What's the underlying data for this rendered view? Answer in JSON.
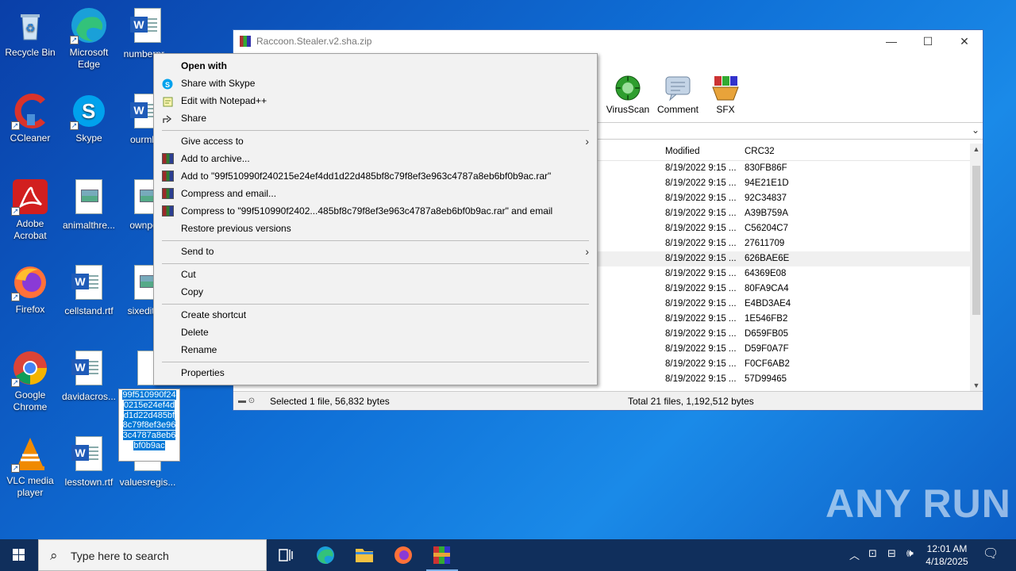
{
  "desktop": {
    "icons": [
      {
        "label": "Recycle Bin"
      },
      {
        "label": "Microsoft Edge"
      },
      {
        "label": "numberpr..."
      },
      {
        "label": "CCleaner"
      },
      {
        "label": "Skype"
      },
      {
        "label": "ourmb..."
      },
      {
        "label": "Adobe Acrobat"
      },
      {
        "label": "animalthre..."
      },
      {
        "label": "ownpo..."
      },
      {
        "label": "Firefox"
      },
      {
        "label": "cellstand.rtf"
      },
      {
        "label": "sixedito..."
      },
      {
        "label": "Google Chrome"
      },
      {
        "label": "davidacros..."
      },
      {
        "label": "VLC media player"
      },
      {
        "label": "lesstown.rtf"
      },
      {
        "label": "valuesregis..."
      }
    ],
    "rename_text": "99f510990f240215e24ef4dd1d22d485bf8c79f8ef3e963c4787a8eb6bf0b9ac"
  },
  "winrar": {
    "title": "Raccoon.Stealer.v2.sha.zip",
    "controls": {
      "minimize": "—",
      "maximize": "☐",
      "close": "✕"
    },
    "toolbar": [
      {
        "label": "VirusScan",
        "icon": "virusscan-icon"
      },
      {
        "label": "Comment",
        "icon": "comment-icon"
      },
      {
        "label": "SFX",
        "icon": "sfx-icon"
      }
    ],
    "columns": {
      "modified": "Modified",
      "crc": "CRC32"
    },
    "rows": [
      {
        "modified": "8/19/2022 9:15 ...",
        "crc": "830FB86F"
      },
      {
        "modified": "8/19/2022 9:15 ...",
        "crc": "94E21E1D"
      },
      {
        "modified": "8/19/2022 9:15 ...",
        "crc": "92C34837"
      },
      {
        "modified": "8/19/2022 9:15 ...",
        "crc": "A39B759A"
      },
      {
        "modified": "8/19/2022 9:15 ...",
        "crc": "C56204C7"
      },
      {
        "modified": "8/19/2022 9:15 ...",
        "crc": "27611709"
      },
      {
        "modified": "8/19/2022 9:15 ...",
        "crc": "626BAE6E"
      },
      {
        "modified": "8/19/2022 9:15 ...",
        "crc": "64369E08"
      },
      {
        "modified": "8/19/2022 9:15 ...",
        "crc": "80FA9CA4"
      },
      {
        "modified": "8/19/2022 9:15 ...",
        "crc": "E4BD3AE4"
      },
      {
        "modified": "8/19/2022 9:15 ...",
        "crc": "1E546FB2"
      },
      {
        "modified": "8/19/2022 9:15 ...",
        "crc": "D659FB05"
      },
      {
        "modified": "8/19/2022 9:15 ...",
        "crc": "D59F0A7F"
      },
      {
        "modified": "8/19/2022 9:15 ...",
        "crc": "F0CF6AB2"
      },
      {
        "modified": "8/19/2022 9:15 ...",
        "crc": "57D99465"
      }
    ],
    "status_left": "Selected 1 file, 56,832 bytes",
    "status_right": "Total 21 files, 1,192,512 bytes"
  },
  "context_menu": {
    "open_with": "Open with",
    "share_skype": "Share with Skype",
    "edit_notepad": "Edit with Notepad++",
    "share": "Share",
    "give_access": "Give access to",
    "add_archive": "Add to archive...",
    "add_to_rar": "Add to \"99f510990f240215e24ef4dd1d22d485bf8c79f8ef3e963c4787a8eb6bf0b9ac.rar\"",
    "compress_email": "Compress and email...",
    "compress_to_rar_email": "Compress to \"99f510990f2402...485bf8c79f8ef3e963c4787a8eb6bf0b9ac.rar\" and email",
    "restore": "Restore previous versions",
    "send_to": "Send to",
    "cut": "Cut",
    "copy": "Copy",
    "create_shortcut": "Create shortcut",
    "delete": "Delete",
    "rename": "Rename",
    "properties": "Properties"
  },
  "taskbar": {
    "search_placeholder": "Type here to search",
    "time": "12:01 AM",
    "date": "4/18/2025"
  },
  "watermark": "ANY RUN"
}
